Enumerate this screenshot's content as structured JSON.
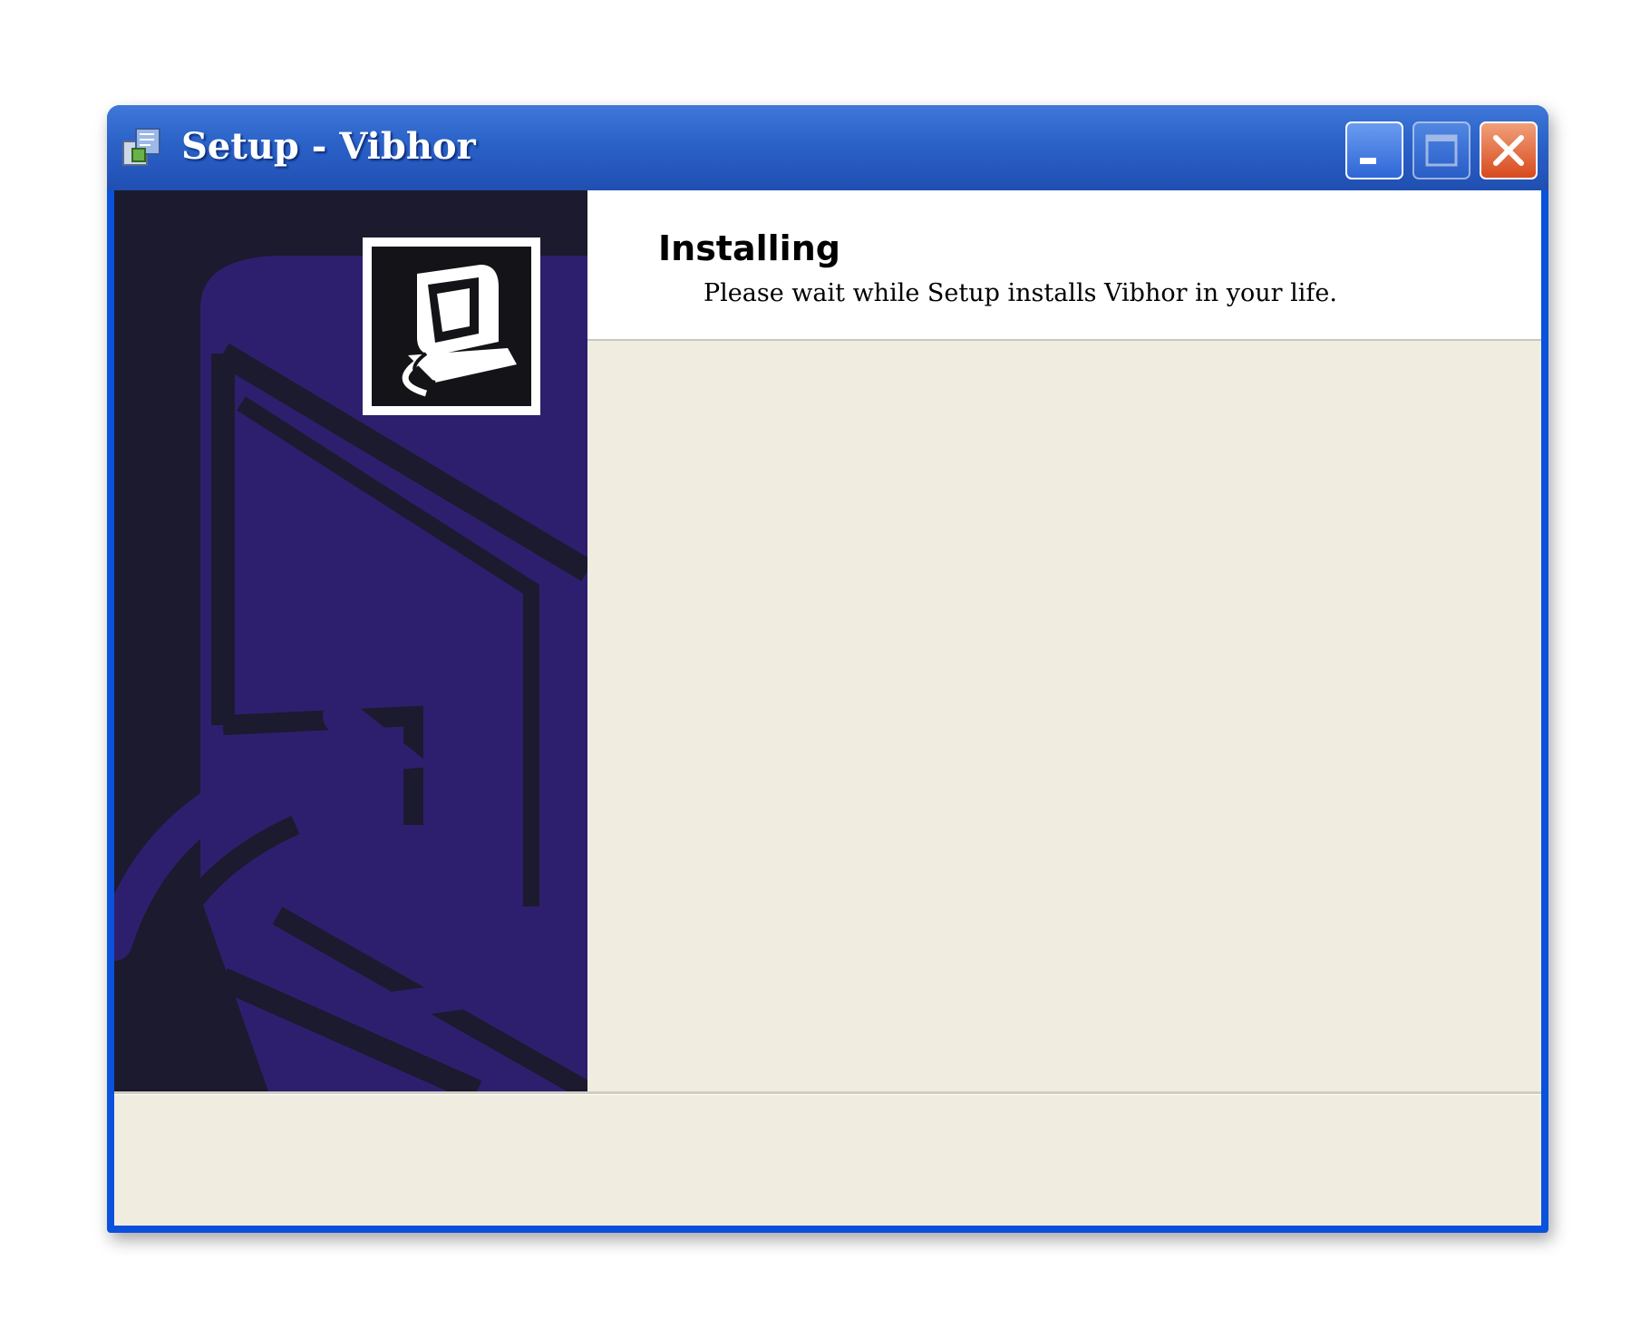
{
  "window": {
    "title": "Setup - Vibhor"
  },
  "titlebar": {
    "icon": "setup-installer-icon",
    "buttons": [
      "minimize-icon",
      "maximize-icon",
      "close-icon"
    ]
  },
  "sidebar": {
    "image": "wizard-sidebar-image",
    "logo_icon": "computer-install-icon",
    "colors": {
      "background": "#1c1a2e",
      "shape": "#2e1f6e"
    }
  },
  "header": {
    "title": "Installing",
    "subtitle": "Please wait while Setup installs Vibhor in your life."
  },
  "colors": {
    "titlebar": "#2a62c8",
    "close_button": "#d84a1e",
    "dialog_background": "#ece9d8"
  }
}
